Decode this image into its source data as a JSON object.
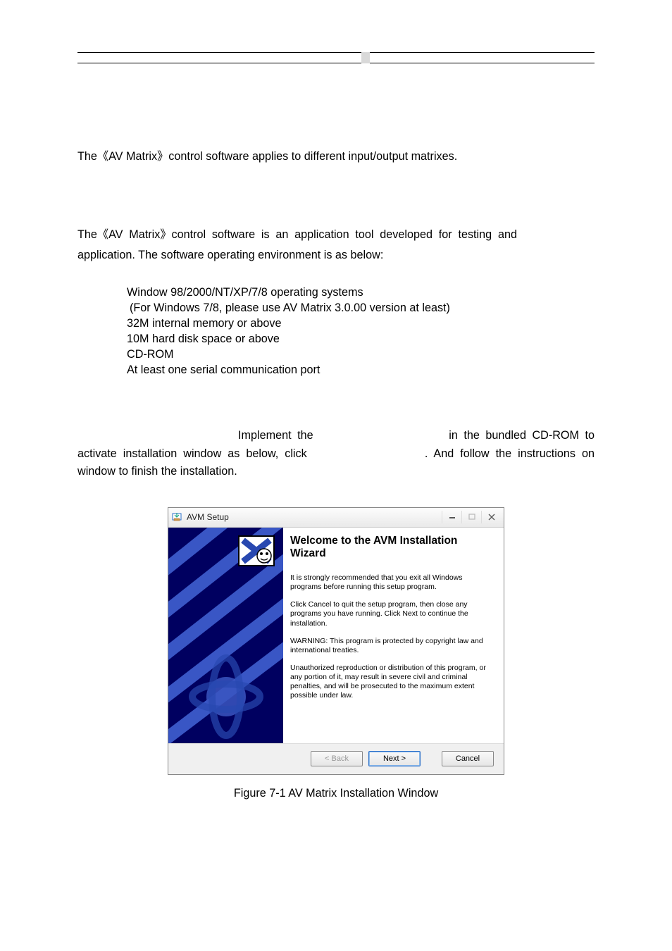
{
  "doc": {
    "intro": "The《AV Matrix》control software applies to different input/output matrixes.",
    "env_line_a": "The《AV Matrix》control software is an application tool developed for testing and",
    "env_line_b": "application. The software operating environment is as below:",
    "reqs": {
      "r1": "Window 98/2000/NT/XP/7/8 operating systems",
      "r2": " (For Windows 7/8, please use AV Matrix 3.0.00 version at least)",
      "r3": "32M internal memory or above",
      "r4": "10M hard disk space or above",
      "r5": "CD-ROM",
      "r6": "At least one serial communication port"
    },
    "install_l1_a": "Implement the",
    "install_l1_b": "in the bundled CD-ROM to",
    "install_l2_a": "activate installation window as below, click",
    "install_l2_b": ". And follow the instructions on",
    "install_l3": "window to finish the installation.",
    "figure_caption": "Figure 7-1 AV Matrix Installation Window"
  },
  "installer": {
    "title": "AVM Setup",
    "heading": "Welcome to the AVM Installation Wizard",
    "p1": "It is strongly recommended that you exit all Windows programs before running this setup program.",
    "p2": "Click Cancel to quit the setup program, then close any programs you have running.  Click Next to continue the installation.",
    "p3": "WARNING: This program is protected by copyright law and international treaties.",
    "p4": "Unauthorized reproduction or distribution of this program, or any portion of it, may result in severe civil and criminal penalties, and will be prosecuted to the maximum extent possible under law.",
    "buttons": {
      "back": "< Back",
      "next": "Next >",
      "cancel": "Cancel"
    }
  }
}
